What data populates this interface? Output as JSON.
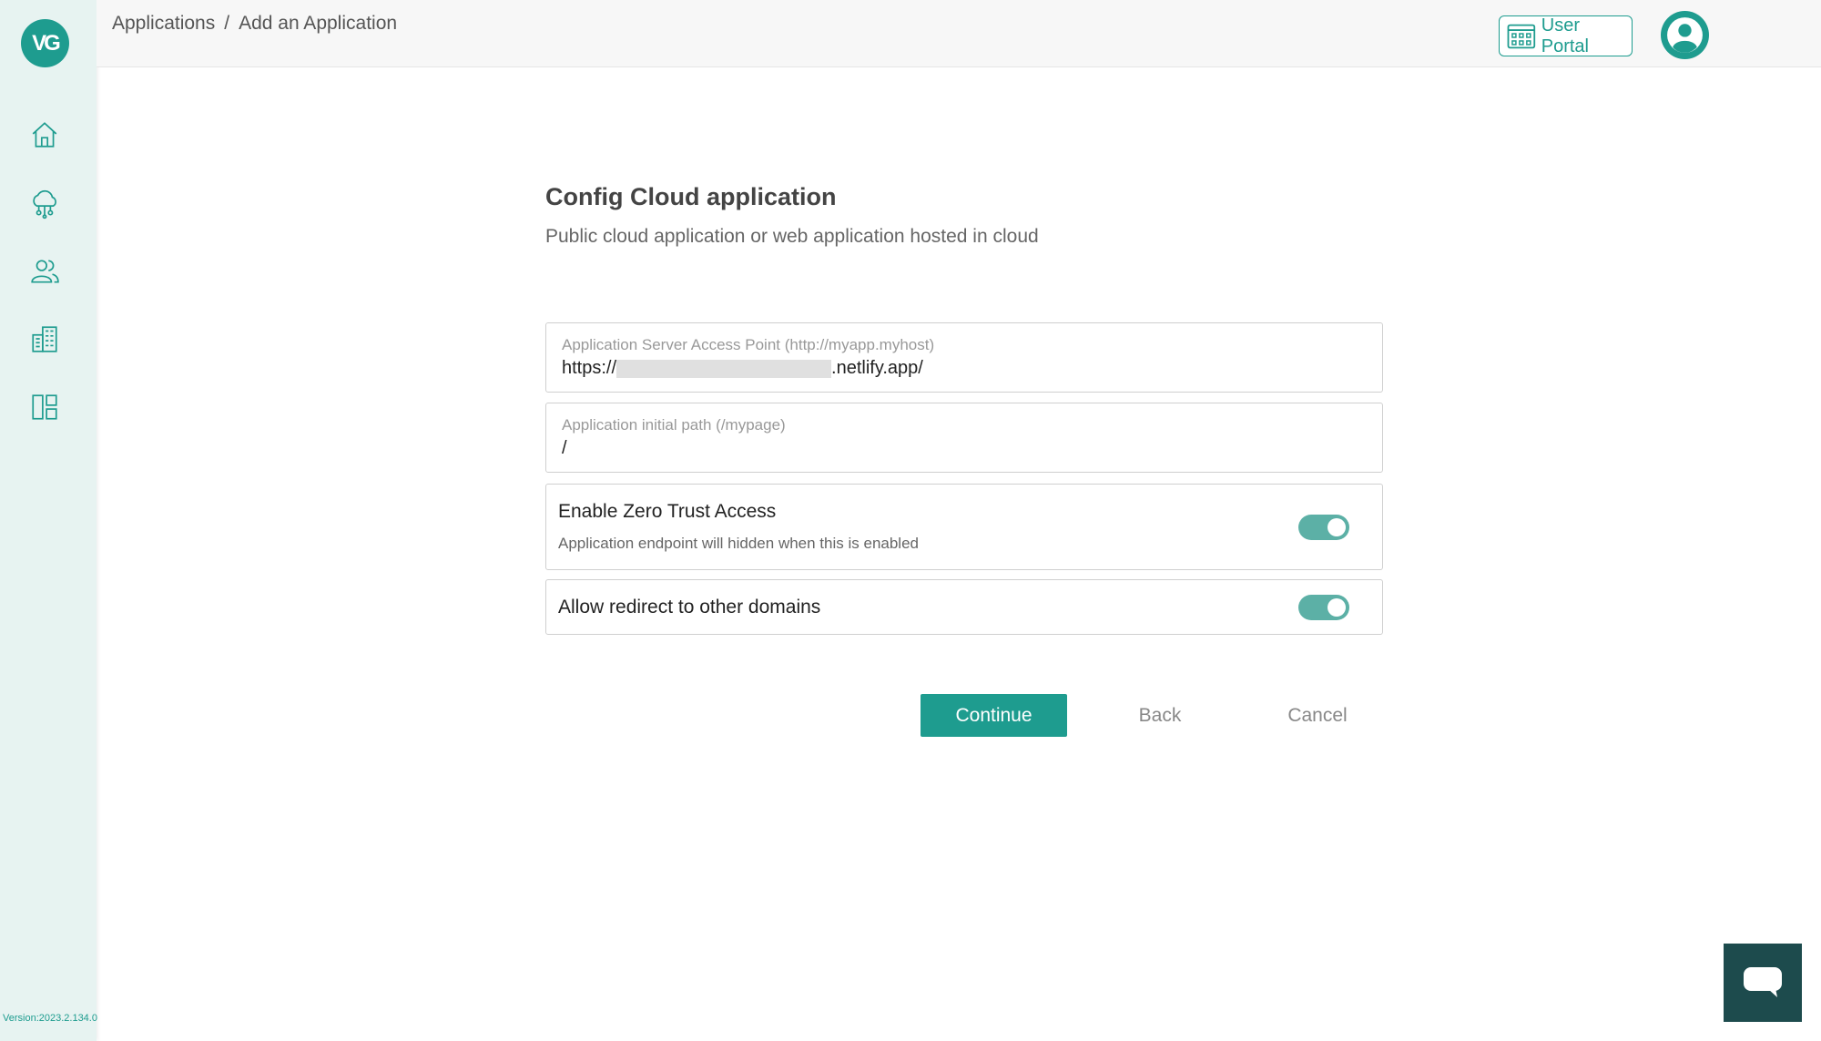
{
  "sidebar": {
    "logo_text": "VG",
    "nav_items": [
      {
        "icon": "home-icon"
      },
      {
        "icon": "cloud-network-icon"
      },
      {
        "icon": "users-icon"
      },
      {
        "icon": "building-icon"
      },
      {
        "icon": "layout-icon"
      }
    ],
    "version": "Version:2023.2.134.0"
  },
  "header": {
    "breadcrumb": {
      "root": "Applications",
      "separator": "/",
      "current": "Add an Application"
    },
    "user_portal_label": "User Portal"
  },
  "main": {
    "title": "Config Cloud application",
    "subtitle": "Public cloud application or web application hosted in cloud",
    "access_point": {
      "label": "Application Server Access Point (http://myapp.myhost)",
      "value_prefix": "https://",
      "value_suffix": ".netlify.app/"
    },
    "initial_path": {
      "label": "Application initial path (/mypage)",
      "value": "/"
    },
    "zero_trust": {
      "title": "Enable Zero Trust Access",
      "description": "Application endpoint will hidden when this is enabled",
      "enabled": true
    },
    "redirect": {
      "title": "Allow redirect to other domains",
      "enabled": true
    },
    "buttons": {
      "continue": "Continue",
      "back": "Back",
      "cancel": "Cancel"
    }
  },
  "colors": {
    "accent": "#1e9c8f",
    "sidebar_bg": "#e7f3f1",
    "chat_bg": "#1d4b4d",
    "toggle_on": "#5cb0a6"
  }
}
